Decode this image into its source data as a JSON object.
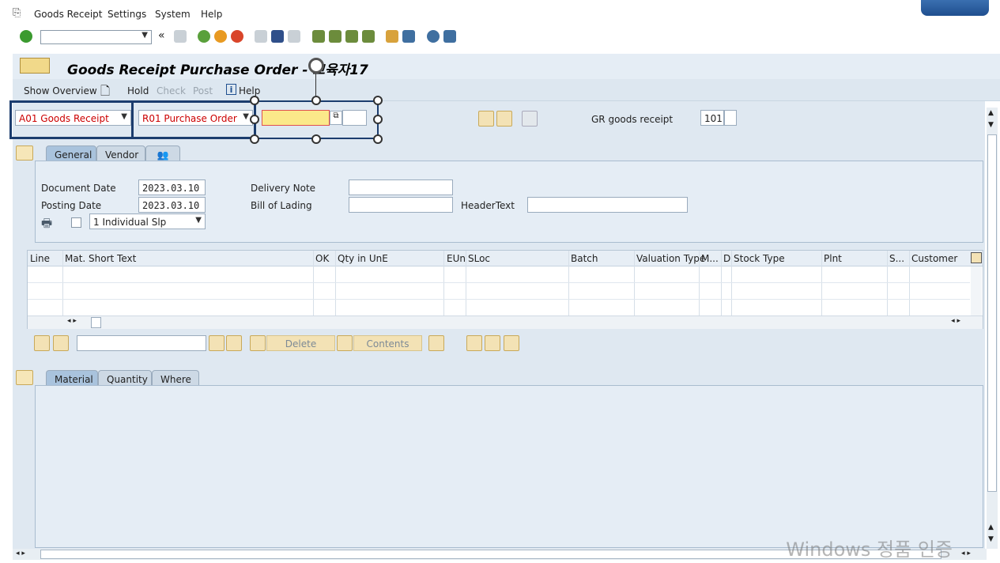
{
  "menu": {
    "items": [
      {
        "label": "Goods Receipt"
      },
      {
        "label": "Settings"
      },
      {
        "label": "System"
      },
      {
        "label": "Help"
      }
    ]
  },
  "window": {
    "title": "Goods Receipt Purchase Order - 교육자17"
  },
  "app_toolbar": {
    "show_overview": "Show Overview",
    "hold": "Hold",
    "check": "Check",
    "post": "Post",
    "help": "Help"
  },
  "header": {
    "action_select": "A01 Goods Receipt",
    "ref_select": "R01 Purchase Order",
    "po_field_value": "",
    "gr_label": "GR goods receipt",
    "movement_type": "101"
  },
  "tabs_top": [
    {
      "label": "General"
    },
    {
      "label": "Vendor"
    }
  ],
  "general": {
    "document_date_label": "Document Date",
    "document_date": "2023.03.10",
    "posting_date_label": "Posting Date",
    "posting_date": "2023.03.10",
    "delivery_note_label": "Delivery Note",
    "bill_of_lading_label": "Bill of Lading",
    "header_text_label": "HeaderText",
    "slip_select": "1 Individual Slp"
  },
  "table": {
    "columns": [
      "Line",
      "Mat. Short Text",
      "OK",
      "Qty in UnE",
      "EUn",
      "SLoc",
      "Batch",
      "Valuation Type",
      "M...",
      "D",
      "Stock Type",
      "Plnt",
      "S...",
      "Customer"
    ]
  },
  "item_toolbar": {
    "delete": "Delete",
    "contents": "Contents"
  },
  "tabs_bottom": [
    {
      "label": "Material"
    },
    {
      "label": "Quantity"
    },
    {
      "label": "Where"
    }
  ],
  "watermark": "Windows 정품 인증"
}
